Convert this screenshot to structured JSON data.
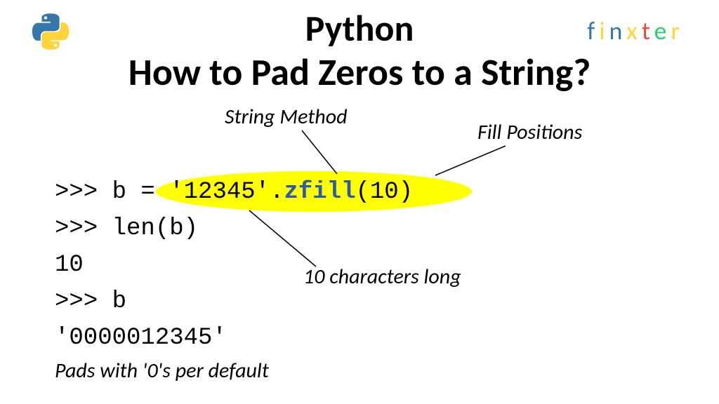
{
  "header": {
    "title_line1": "Python",
    "title_line2": "How to Pad Zeros to a String?"
  },
  "brand": {
    "name": "finxter",
    "letters": [
      "f",
      "i",
      "n",
      "x",
      "t",
      "e",
      "r"
    ]
  },
  "labels": {
    "string_method": "String Method",
    "fill_positions": "Fill Positions",
    "ten_chars": "10 characters long",
    "pads_default": "Pads with '0's per default"
  },
  "code": {
    "line1_prefix": ">>> b = ",
    "line1_literal": "'12345'",
    "line1_dot": ".",
    "line1_method": "zfill",
    "line1_args": "(10)",
    "line2": ">>> len(b)",
    "line3": "10",
    "line4": ">>> b",
    "line5": "'0000012345'"
  }
}
